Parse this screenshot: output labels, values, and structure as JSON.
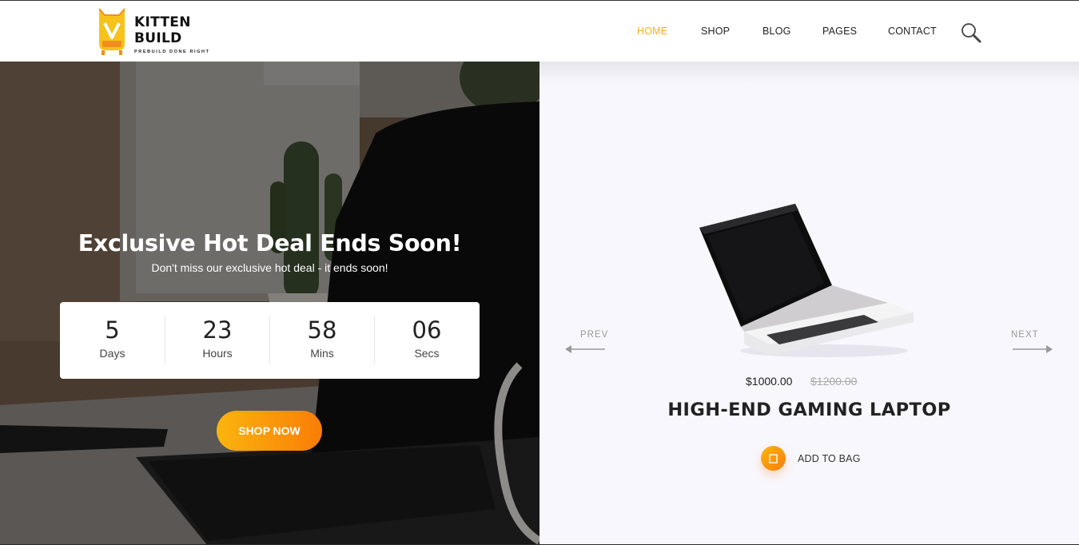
{
  "brand": {
    "name_line1": "KITTEN",
    "name_line2": "BUILD",
    "tagline": "PREBUILD DONE RIGHT",
    "accent_color": "#f5b014",
    "gradient_start": "#fbb40e",
    "gradient_end": "#f97d07"
  },
  "nav": {
    "items": [
      {
        "label": "HOME",
        "active": true
      },
      {
        "label": "SHOP",
        "active": false
      },
      {
        "label": "BLOG",
        "active": false
      },
      {
        "label": "PAGES",
        "active": false
      },
      {
        "label": "CONTACT",
        "active": false
      }
    ],
    "search_icon": "search-icon"
  },
  "hero": {
    "title": "Exclusive Hot Deal Ends Soon!",
    "subtitle": "Don't miss our exclusive hot deal - it ends soon!",
    "countdown": [
      {
        "value": "5",
        "label": "Days"
      },
      {
        "value": "23",
        "label": "Hours"
      },
      {
        "value": "58",
        "label": "Mins"
      },
      {
        "value": "06",
        "label": "Secs"
      }
    ],
    "cta_label": "SHOP NOW"
  },
  "product": {
    "prev_label": "PREV",
    "next_label": "NEXT",
    "price": "$1000.00",
    "old_price": "$1200.00",
    "name": "HIGH-END GAMING LAPTOP",
    "add_to_bag_label": "ADD TO BAG",
    "bag_icon": "bag-icon"
  }
}
